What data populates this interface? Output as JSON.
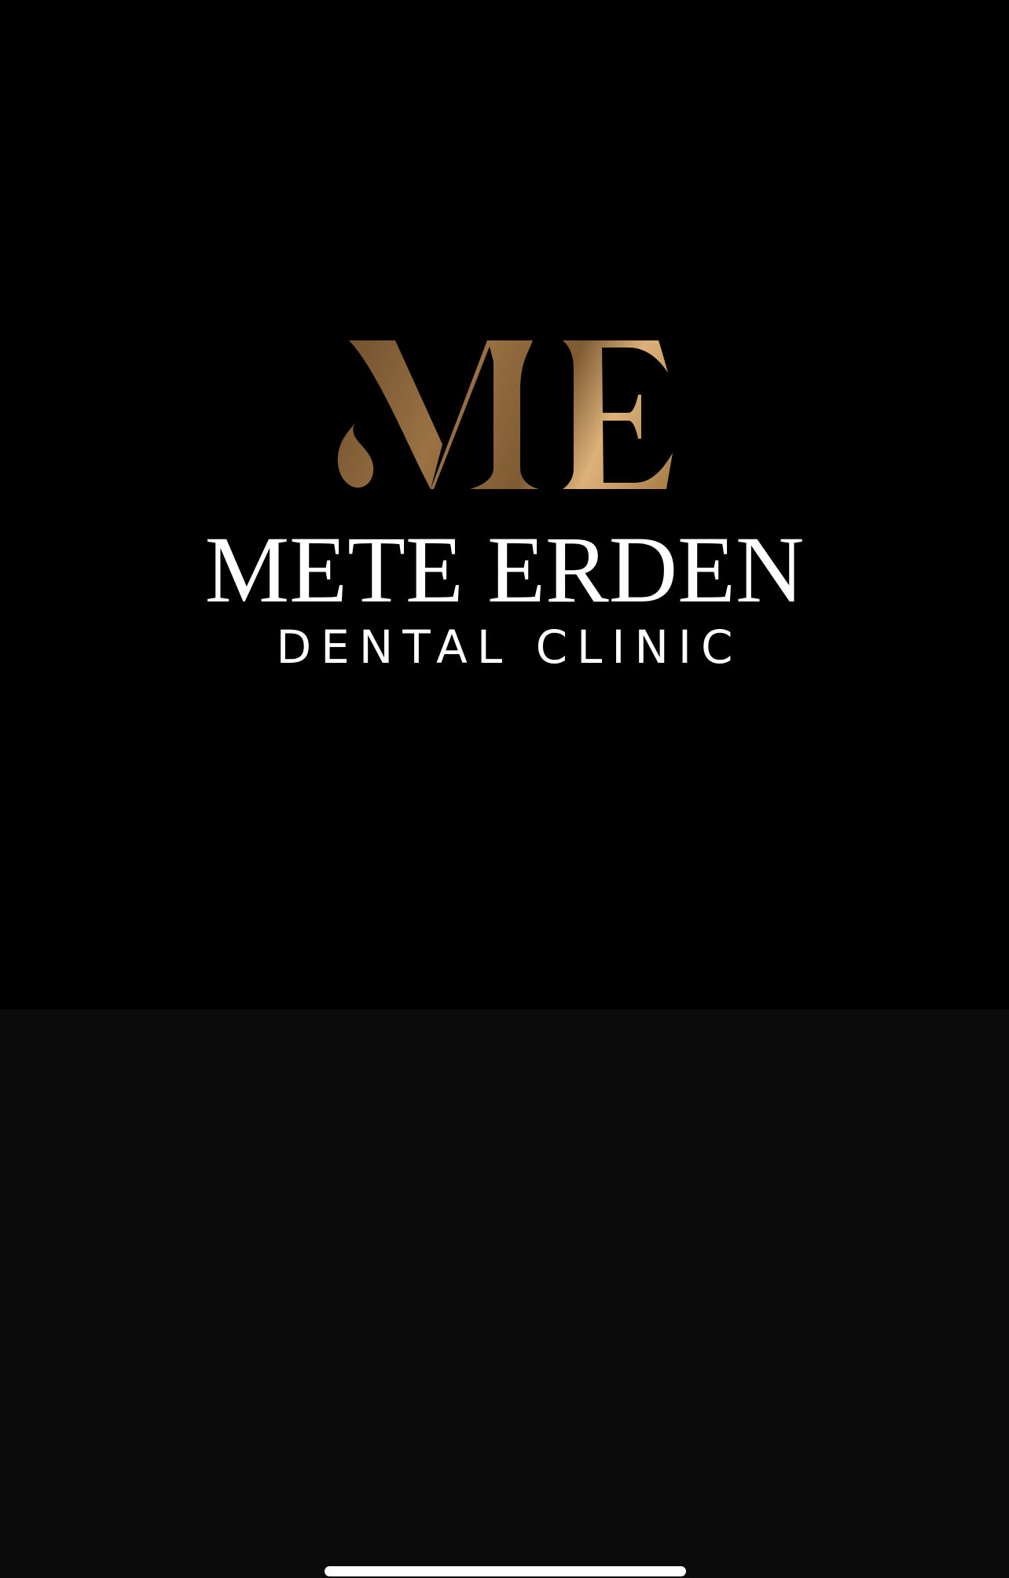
{
  "brand": {
    "monogram": "ME",
    "name": "METE ERDEN",
    "subtitle": "DENTAL CLINIC"
  },
  "colors": {
    "splash_background": "#000000",
    "lower_background": "#0b0b0b",
    "text": "#ffffff",
    "gold_dark": "#8a6437",
    "gold_light": "#dcb27a"
  }
}
